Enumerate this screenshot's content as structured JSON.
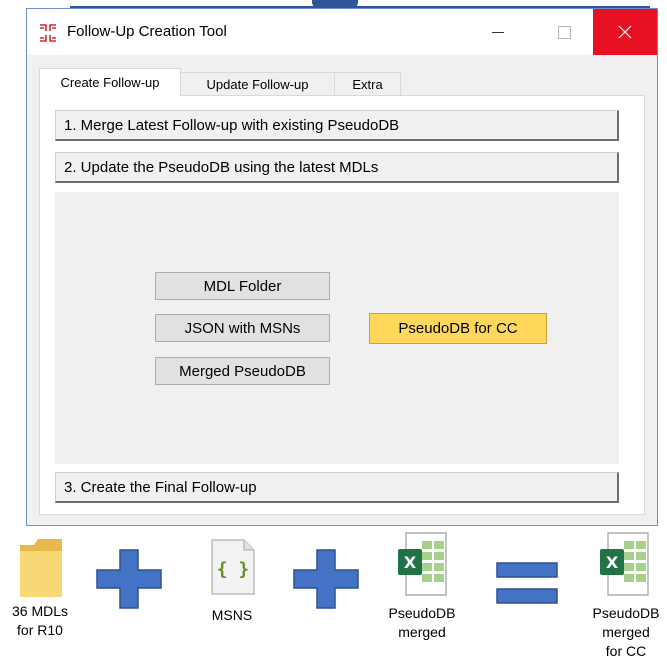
{
  "window": {
    "title": "Follow-Up Creation Tool",
    "app_icon": "app-grid-icon",
    "controls": {
      "minimize": "minimize-icon",
      "maximize": "maximize-icon",
      "close": "close-icon"
    }
  },
  "tabs": [
    {
      "label": "Create Follow-up",
      "active": true
    },
    {
      "label": "Update Follow-up",
      "active": false
    },
    {
      "label": "Extra",
      "active": false
    }
  ],
  "sections": {
    "merge_label": "1. Merge Latest Follow-up with existing PseudoDB",
    "update_label": "2. Update the PseudoDB using the latest MDLs",
    "final_label": "3. Create the Final Follow-up"
  },
  "inputs": {
    "mdl_folder_label": "MDL Folder",
    "json_msns_label": "JSON with MSNs",
    "merged_pseudodb_label": "Merged PseudoDB",
    "pseudodb_cc_label": "PseudoDB for CC"
  },
  "equation": {
    "folder": {
      "line1": "36 MDLs",
      "line2": "for R10",
      "icon": "folder-icon"
    },
    "json": {
      "line1": "MSNS",
      "icon": "json-file-icon"
    },
    "excel_merged": {
      "line1": "PseudoDB",
      "line2": "merged",
      "icon": "excel-file-icon"
    },
    "excel_cc": {
      "line1": "PseudoDB",
      "line2": "merged",
      "line3": "for CC",
      "icon": "excel-file-icon"
    },
    "operators": {
      "plus": "plus-icon",
      "equals": "equals-icon"
    }
  },
  "colors": {
    "accent_blue": "#4472c4",
    "highlight_yellow": "#ffd75a",
    "close_red": "#e81123",
    "excel_green": "#217346",
    "folder_yellow": "#f8d775"
  }
}
